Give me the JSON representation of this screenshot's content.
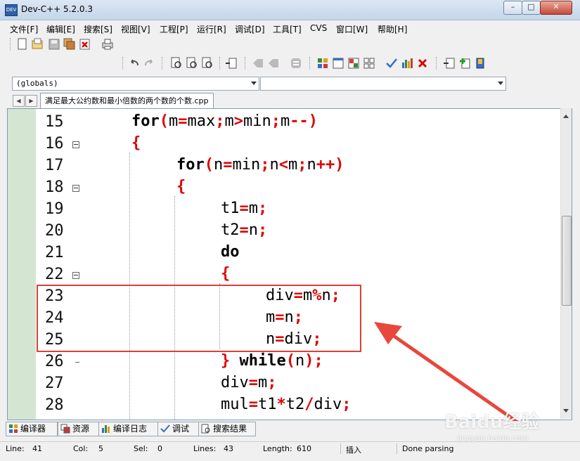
{
  "window": {
    "title": "Dev-C++ 5.2.0.3",
    "icon_label": "DEV"
  },
  "menu": [
    "文件[F]",
    "编辑[E]",
    "搜索[S]",
    "视图[V]",
    "工程[P]",
    "运行[R]",
    "调试[D]",
    "工具[T]",
    "CVS",
    "窗口[W]",
    "帮助[H]"
  ],
  "combos": {
    "left": "(globals)",
    "right": ""
  },
  "file_tab": "满足最大公约数和最小倍数的两个数的个数.cpp",
  "code_lines": [
    {
      "n": "15",
      "code": [
        [
          "kw",
          "for"
        ],
        [
          "op",
          "("
        ],
        [
          "t",
          "m"
        ],
        [
          "op",
          "="
        ],
        [
          "t",
          "max"
        ],
        [
          "op",
          ";"
        ],
        [
          "t",
          "m"
        ],
        [
          "op",
          ">"
        ],
        [
          "t",
          "min"
        ],
        [
          "op",
          ";"
        ],
        [
          "t",
          "m"
        ],
        [
          "op",
          "--)"
        ]
      ]
    },
    {
      "n": "16",
      "code": [
        [
          "op",
          "{"
        ]
      ]
    },
    {
      "n": "17",
      "code": [
        [
          "kw",
          "for"
        ],
        [
          "op",
          "("
        ],
        [
          "t",
          "n"
        ],
        [
          "op",
          "="
        ],
        [
          "t",
          "min"
        ],
        [
          "op",
          ";"
        ],
        [
          "t",
          "n"
        ],
        [
          "op",
          "<"
        ],
        [
          "t",
          "m"
        ],
        [
          "op",
          ";"
        ],
        [
          "t",
          "n"
        ],
        [
          "op",
          "++)"
        ]
      ]
    },
    {
      "n": "18",
      "code": [
        [
          "op",
          "{"
        ]
      ]
    },
    {
      "n": "19",
      "code": [
        [
          "t",
          "t1"
        ],
        [
          "op",
          "="
        ],
        [
          "t",
          "m"
        ],
        [
          "op",
          ";"
        ]
      ]
    },
    {
      "n": "20",
      "code": [
        [
          "t",
          "t2"
        ],
        [
          "op",
          "="
        ],
        [
          "t",
          "n"
        ],
        [
          "op",
          ";"
        ]
      ]
    },
    {
      "n": "21",
      "code": [
        [
          "kw",
          "do"
        ]
      ]
    },
    {
      "n": "22",
      "code": [
        [
          "op",
          "{"
        ]
      ]
    },
    {
      "n": "23",
      "code": [
        [
          "t",
          "div"
        ],
        [
          "op",
          "="
        ],
        [
          "t",
          "m"
        ],
        [
          "op",
          "%"
        ],
        [
          "t",
          "n"
        ],
        [
          "op",
          ";"
        ]
      ]
    },
    {
      "n": "24",
      "code": [
        [
          "t",
          "m"
        ],
        [
          "op",
          "="
        ],
        [
          "t",
          "n"
        ],
        [
          "op",
          ";"
        ]
      ]
    },
    {
      "n": "25",
      "code": [
        [
          "t",
          "n"
        ],
        [
          "op",
          "="
        ],
        [
          "t",
          "div"
        ],
        [
          "op",
          ";"
        ]
      ]
    },
    {
      "n": "26",
      "code": [
        [
          "op",
          "}"
        ],
        [
          "t",
          " "
        ],
        [
          "kw",
          "while"
        ],
        [
          "op",
          "("
        ],
        [
          "t",
          "n"
        ],
        [
          "op",
          ");"
        ]
      ]
    },
    {
      "n": "27",
      "code": [
        [
          "t",
          "div"
        ],
        [
          "op",
          "="
        ],
        [
          "t",
          "m"
        ],
        [
          "op",
          ";"
        ]
      ]
    },
    {
      "n": "28",
      "code": [
        [
          "t",
          "mul"
        ],
        [
          "op",
          "="
        ],
        [
          "t",
          "t1"
        ],
        [
          "op",
          "*"
        ],
        [
          "t",
          "t2"
        ],
        [
          "op",
          "/"
        ],
        [
          "t",
          "div"
        ],
        [
          "op",
          ";"
        ]
      ]
    }
  ],
  "bottom_tabs": [
    "编译器",
    "资源",
    "编译日志",
    "调试",
    "搜索结果"
  ],
  "status": {
    "line_label": "Line:",
    "line": "41",
    "col_label": "Col:",
    "col": "5",
    "sel_label": "Sel:",
    "sel": "0",
    "lines_label": "Lines:",
    "lines": "43",
    "length_label": "Length:",
    "length": "610",
    "mode": "插入",
    "message": "Done parsing"
  },
  "watermark": {
    "brand": "Baidu经验",
    "url": "jingyan.baidu.com"
  },
  "colors": {
    "operator": "#e00000",
    "annotation": "#d9403a",
    "gutter": "#d4e6d1"
  }
}
